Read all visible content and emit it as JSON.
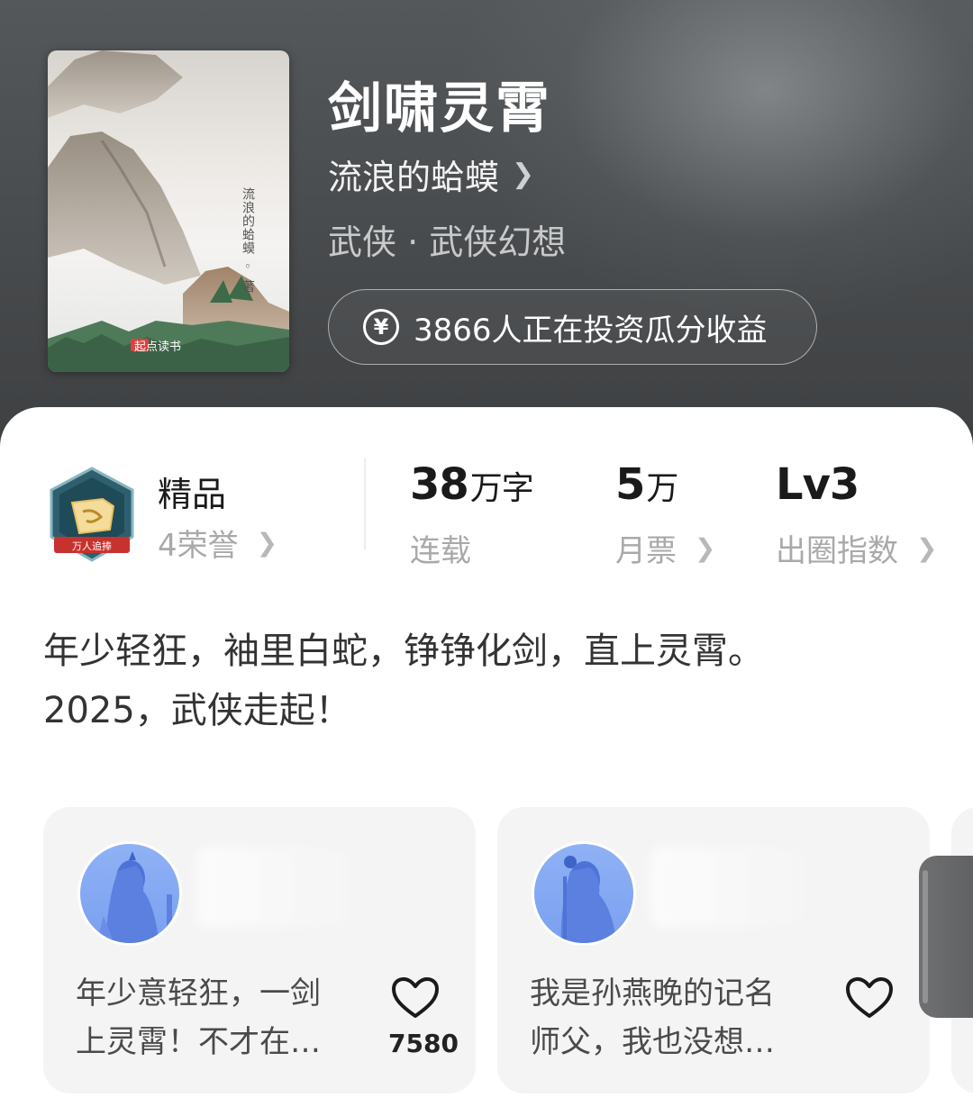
{
  "book": {
    "title": "剑啸灵霄",
    "author": "流浪的蛤蟆",
    "genre": "武侠 · 武侠幻想",
    "invest_text": "3866人正在投资瓜分收益",
    "cover_author": "流浪的蛤蟆 ◦ 著",
    "cover_brand": "起点读书"
  },
  "honor": {
    "title": "精品",
    "subtitle": "4荣誉",
    "badge_text": "万人追捧"
  },
  "stats": [
    {
      "value": "38",
      "unit": "万字",
      "label": "连载",
      "has_chevron": false
    },
    {
      "value": "5",
      "unit": "万",
      "label": "月票",
      "has_chevron": true
    },
    {
      "value": "Lv3",
      "unit": "",
      "label": "出圈指数",
      "has_chevron": true
    }
  ],
  "synopsis": "年少轻狂，袖里白蛇，铮铮化剑，直上灵霄。\n2025，武侠走起！",
  "comments": [
    {
      "text": "年少意轻狂，一剑上灵霄！不才在…",
      "likes": "7580"
    },
    {
      "text": "我是孙燕晚的记名师父，我也没想…",
      "likes": ""
    }
  ],
  "icons": {
    "chevron": "chevron-right-icon",
    "yen": "yen-coin-icon",
    "heart": "heart-outline-icon"
  },
  "colors": {
    "header_bg": "#4a4d4f",
    "avatar_blue": "#7aa0f0",
    "card_bg": "#f4f4f4"
  }
}
